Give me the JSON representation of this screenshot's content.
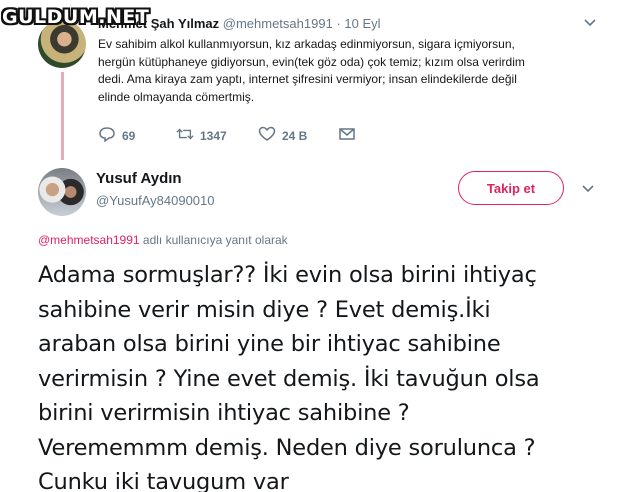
{
  "watermark": "GULDUM.NET",
  "parent_tweet": {
    "author_name": "Mehmet Şah Yılmaz",
    "handle": "@mehmetsah1991",
    "separator": "·",
    "time": "10 Eyl",
    "text_lines": [
      "Ev sahibim alkol kullanmıyorsun, kız arkadaş edinmiyorsun, sigara içmiyorsun,",
      "hergün kütüphaneye gidiyorsun, evin(tek göz oda) çok temiz; kızım olsa verirdim",
      "dedi. Ama kiraya zam yaptı, internet şifresini vermiyor; insan elindekilerde değil",
      "elinde olmayanda cömertmiş."
    ],
    "actions": {
      "replies": "69",
      "retweets": "1347",
      "likes": "24 B"
    },
    "icons": [
      "reply-icon",
      "retweet-icon",
      "heart-icon",
      "message-icon",
      "chevron-down-icon"
    ]
  },
  "main_tweet": {
    "author_name": "Yusuf Aydın",
    "handle": "@YusufAy84090010",
    "follow_label": "Takip et",
    "reply_mention": "@mehmetsah1991",
    "reply_suffix": " adlı kullanıcıya yanıt olarak",
    "text_lines": [
      "Adama sormuşlar?? İki evin olsa birini ihtiyaç",
      "sahibine verir misin diye ? Evet demiş.İki",
      "araban olsa birini yine bir ihtiyac sahibine",
      "verirmisin ? Yine evet demiş. İki tavuğun olsa",
      "birini verirmisin ihtiyac sahibine ?",
      "Verememmm demiş. Neden diye sorulunca ?",
      "Cunku iki tavugum var"
    ]
  },
  "colors": {
    "accent": "#e0245e",
    "muted": "#657786",
    "text": "#14171a",
    "thread_line": "#e8a9b8"
  }
}
